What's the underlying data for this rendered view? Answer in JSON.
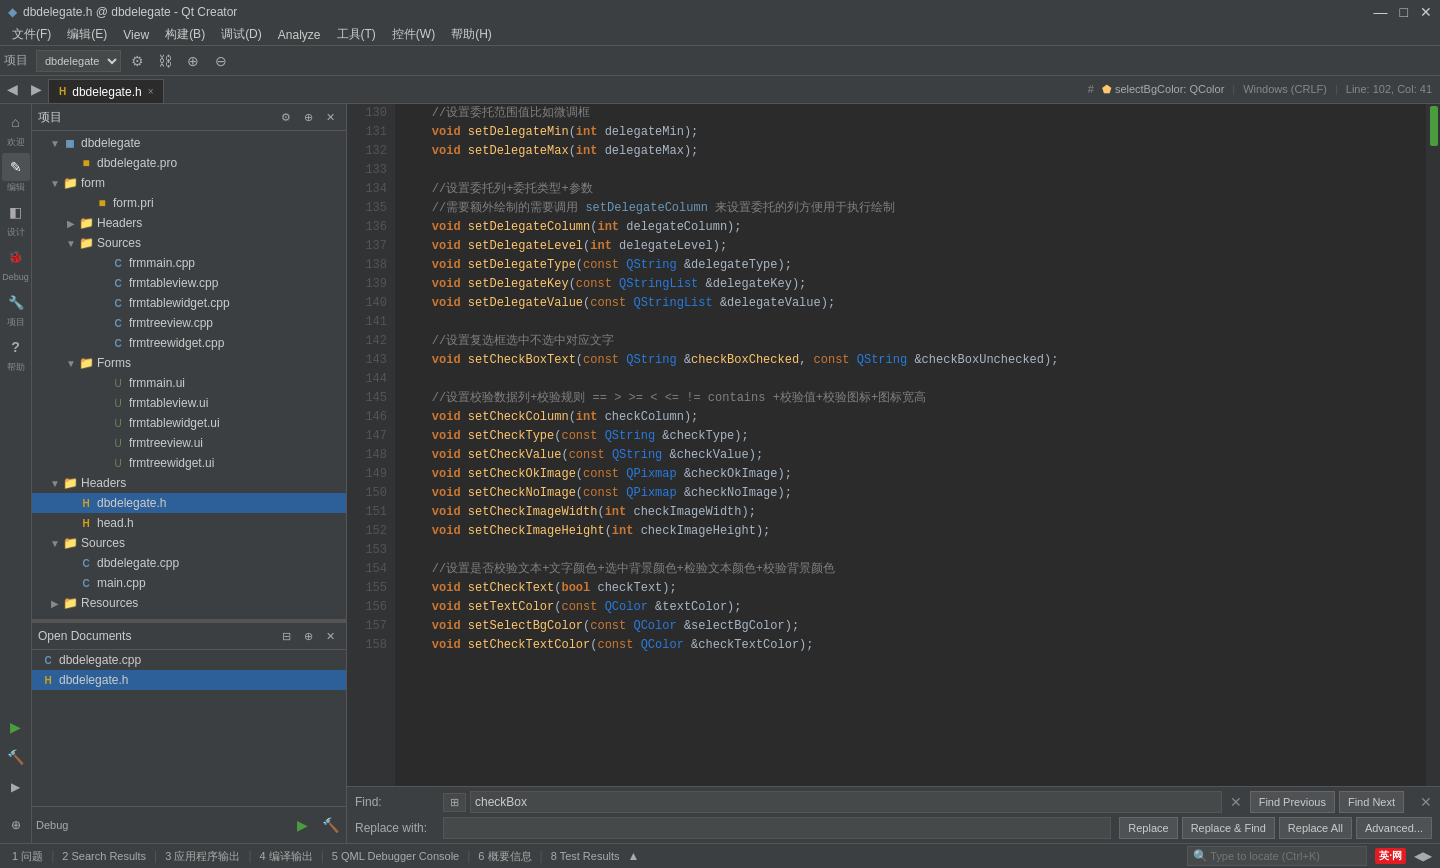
{
  "titlebar": {
    "title": "dbdelegate.h @ dbdelegate - Qt Creator",
    "icon": "◆",
    "btn_min": "—",
    "btn_max": "□",
    "btn_close": "✕"
  },
  "menubar": {
    "items": [
      "文件(F)",
      "编辑(E)",
      "View",
      "构建(B)",
      "调试(D)",
      "Analyze",
      "工具(T)",
      "控件(W)",
      "帮助(H)"
    ]
  },
  "toolbar": {
    "project_label": "项目",
    "items": [
      "◀",
      "▶",
      "≡",
      "≈",
      "⊕",
      "⊖"
    ]
  },
  "tab": {
    "filename": "dbdelegate.h",
    "close_icon": "×",
    "hash_icon": "#",
    "function_label": "selectBgColor: QColor",
    "line_info": "Line: 102, Col: 41",
    "encoding": "Windows (CRLF)"
  },
  "sidebar_icons": [
    {
      "id": "welcome",
      "label": "欢迎",
      "icon": "⌂"
    },
    {
      "id": "edit",
      "label": "编辑",
      "icon": "✎"
    },
    {
      "id": "design",
      "label": "设计",
      "icon": "◧"
    },
    {
      "id": "debug",
      "label": "Debug",
      "icon": "⚙"
    },
    {
      "id": "projects",
      "label": "项目",
      "icon": "🔧"
    },
    {
      "id": "help",
      "label": "帮助",
      "icon": "?"
    },
    {
      "id": "debug2",
      "label": "Debug",
      "icon": "▶"
    }
  ],
  "project_tree": {
    "panel_title": "项目",
    "root": {
      "name": "dbdelegate",
      "children": [
        {
          "type": "file",
          "name": "dbdelegate.pro",
          "icon": "pro"
        },
        {
          "type": "folder",
          "name": "form",
          "expanded": true,
          "children": [
            {
              "type": "file",
              "name": "form.pri",
              "icon": "pri"
            },
            {
              "type": "folder",
              "name": "Headers",
              "expanded": false,
              "children": []
            },
            {
              "type": "folder",
              "name": "Sources",
              "expanded": true,
              "children": [
                {
                  "type": "cpp",
                  "name": "frmmain.cpp"
                },
                {
                  "type": "cpp",
                  "name": "frmtableview.cpp"
                },
                {
                  "type": "cpp",
                  "name": "frmtablewidget.cpp"
                },
                {
                  "type": "cpp",
                  "name": "frmtreeview.cpp"
                },
                {
                  "type": "cpp",
                  "name": "frmtreewidget.cpp"
                }
              ]
            },
            {
              "type": "folder",
              "name": "Forms",
              "expanded": true,
              "children": [
                {
                  "type": "ui",
                  "name": "frmmain.ui"
                },
                {
                  "type": "ui",
                  "name": "frmtableview.ui"
                },
                {
                  "type": "ui",
                  "name": "frmtablewidget.ui"
                },
                {
                  "type": "ui",
                  "name": "frmtreeview.ui"
                },
                {
                  "type": "ui",
                  "name": "frmtreewidget.ui"
                }
              ]
            }
          ]
        },
        {
          "type": "folder",
          "name": "Headers",
          "expanded": true,
          "children": [
            {
              "type": "header",
              "name": "dbdelegate.h",
              "selected": true
            },
            {
              "type": "header",
              "name": "head.h"
            }
          ]
        },
        {
          "type": "folder",
          "name": "Sources",
          "expanded": true,
          "children": [
            {
              "type": "cpp",
              "name": "dbdelegate.cpp"
            },
            {
              "type": "cpp",
              "name": "main.cpp"
            }
          ]
        },
        {
          "type": "folder",
          "name": "Resources",
          "expanded": false,
          "children": []
        }
      ]
    }
  },
  "open_docs": {
    "panel_title": "Open Documents",
    "items": [
      {
        "name": "dbdelegate.cpp",
        "icon": "cpp"
      },
      {
        "name": "dbdelegate.h",
        "icon": "h",
        "selected": true
      }
    ]
  },
  "code": {
    "lines": [
      {
        "num": 130,
        "content": "    <comment>//设置委托范围值比如微调框</comment>"
      },
      {
        "num": 131,
        "content": "    <kw>void</kw> <fn>setDelegateMin</fn>(<kw>int</kw> delegateMin);"
      },
      {
        "num": 132,
        "content": "    <kw>void</kw> <fn>setDelegateMax</fn>(<kw>int</kw> delegateMax);"
      },
      {
        "num": 133,
        "content": ""
      },
      {
        "num": 134,
        "content": "    <comment>//设置委托列+委托类型+参数</comment>"
      },
      {
        "num": 135,
        "content": "    <comment>//需要额外绘制的需要调用 setDelegateColumn 来设置委托的列方便用于执行绘制</comment>"
      },
      {
        "num": 136,
        "content": "    <kw>void</kw> <fn>setDelegateColumn</fn>(<kw>int</kw> delegateColumn);"
      },
      {
        "num": 137,
        "content": "    <kw>void</kw> <fn>setDelegateLevel</fn>(<kw>int</kw> delegateLevel);"
      },
      {
        "num": 138,
        "content": "    <kw>void</kw> <fn>setDelegateType</fn>(<kw2>const</kw2> <qt-class>QString</qt-class> &amp;delegateType);"
      },
      {
        "num": 139,
        "content": "    <kw>void</kw> <fn>setDelegateKey</fn>(<kw2>const</kw2> <qt-class>QStringList</qt-class> &amp;delegateKey);"
      },
      {
        "num": 140,
        "content": "    <kw>void</kw> <fn>setDelegateValue</fn>(<kw2>const</kw2> <qt-class>QStringList</qt-class> &amp;delegateValue);"
      },
      {
        "num": 141,
        "content": ""
      },
      {
        "num": 142,
        "content": "    <comment>//设置复选框选中不选中对应文字</comment>"
      },
      {
        "num": 143,
        "content": "    <kw>void</kw> <fn>setCheckBoxText</fn>(<kw2>const</kw2> <qt-class>QString</qt-class> &amp;<fn>checkBoxChecked</fn>, <kw2>const</kw2> <qt-class>QString</qt-class> &amp;checkBoxUnchecked);"
      },
      {
        "num": 144,
        "content": ""
      },
      {
        "num": 145,
        "content": "    <comment>//设置校验数据列+校验规则 == &gt; &gt;= &lt; &lt;= != contains +校验值+校验图标+图标宽高</comment>"
      },
      {
        "num": 146,
        "content": "    <kw>void</kw> <fn>setCheckColumn</fn>(<kw>int</kw> checkColumn);"
      },
      {
        "num": 147,
        "content": "    <kw>void</kw> <fn>setCheckType</fn>(<kw2>const</kw2> <qt-class>QString</qt-class> &amp;checkType);"
      },
      {
        "num": 148,
        "content": "    <kw>void</kw> <fn>setCheckValue</fn>(<kw2>const</kw2> <qt-class>QString</qt-class> &amp;checkValue);"
      },
      {
        "num": 149,
        "content": "    <kw>void</kw> <fn>setCheckOkImage</fn>(<kw2>const</kw2> <qt-class>QPixmap</qt-class> &amp;checkOkImage);"
      },
      {
        "num": 150,
        "content": "    <kw>void</kw> <fn>setCheckNoImage</fn>(<kw2>const</kw2> <qt-class>QPixmap</qt-class> &amp;checkNoImage);"
      },
      {
        "num": 151,
        "content": "    <kw>void</kw> <fn>setCheckImageWidth</fn>(<kw>int</kw> checkImageWidth);"
      },
      {
        "num": 152,
        "content": "    <kw>void</kw> <fn>setCheckImageHeight</fn>(<kw>int</kw> checkImageHeight);"
      },
      {
        "num": 153,
        "content": ""
      },
      {
        "num": 154,
        "content": "    <comment>//设置是否校验文本+文字颜色+选中背景颜色+检验文本颜色+校验背景颜色</comment>"
      },
      {
        "num": 155,
        "content": "    <kw>void</kw> <fn>setCheckText</fn>(<kw>bool</kw> checkText);"
      },
      {
        "num": 156,
        "content": "    <kw>void</kw> <fn>setTextColor</fn>(<kw2>const</kw2> <qt-class>QColor</qt-class> &amp;textColor);"
      },
      {
        "num": 157,
        "content": "    <kw>void</kw> <fn>setSelectBgColor</fn>(<kw2>const</kw2> <qt-class>QColor</qt-class> &amp;selectBgColor);"
      },
      {
        "num": 158,
        "content": "    <kw>void</kw> <fn>setCheckTextColor</fn>(<kw2>const</kw2> <qt-class>QColor</qt-class> &amp;checkTextColor);"
      }
    ]
  },
  "find_bar": {
    "find_label": "Find:",
    "find_value": "checkBox",
    "replace_label": "Replace with:",
    "replace_value": "",
    "find_prev": "Find Previous",
    "find_next": "Find Next",
    "replace": "Replace",
    "replace_find": "Replace & Find",
    "replace_all": "Replace All",
    "advanced": "Advanced..."
  },
  "status_bar": {
    "items": [
      "1 问题",
      "2 Search Results",
      "3 应用程序输出",
      "4 编译输出",
      "5 QML Debugger Console",
      "6 概要信息",
      "8 Test Results"
    ],
    "search_placeholder": "Type to locate (Ctrl+K)",
    "logo_text": "英·网"
  },
  "colors": {
    "bg_dark": "#2b2b2b",
    "bg_panel": "#3c3f41",
    "selected": "#2d6099",
    "comment": "#808080",
    "keyword": "#cc7832",
    "function": "#ffc66d",
    "qtclass": "#287bde",
    "string": "#6a8759",
    "scrollbar_green": "#4a9c3e"
  }
}
